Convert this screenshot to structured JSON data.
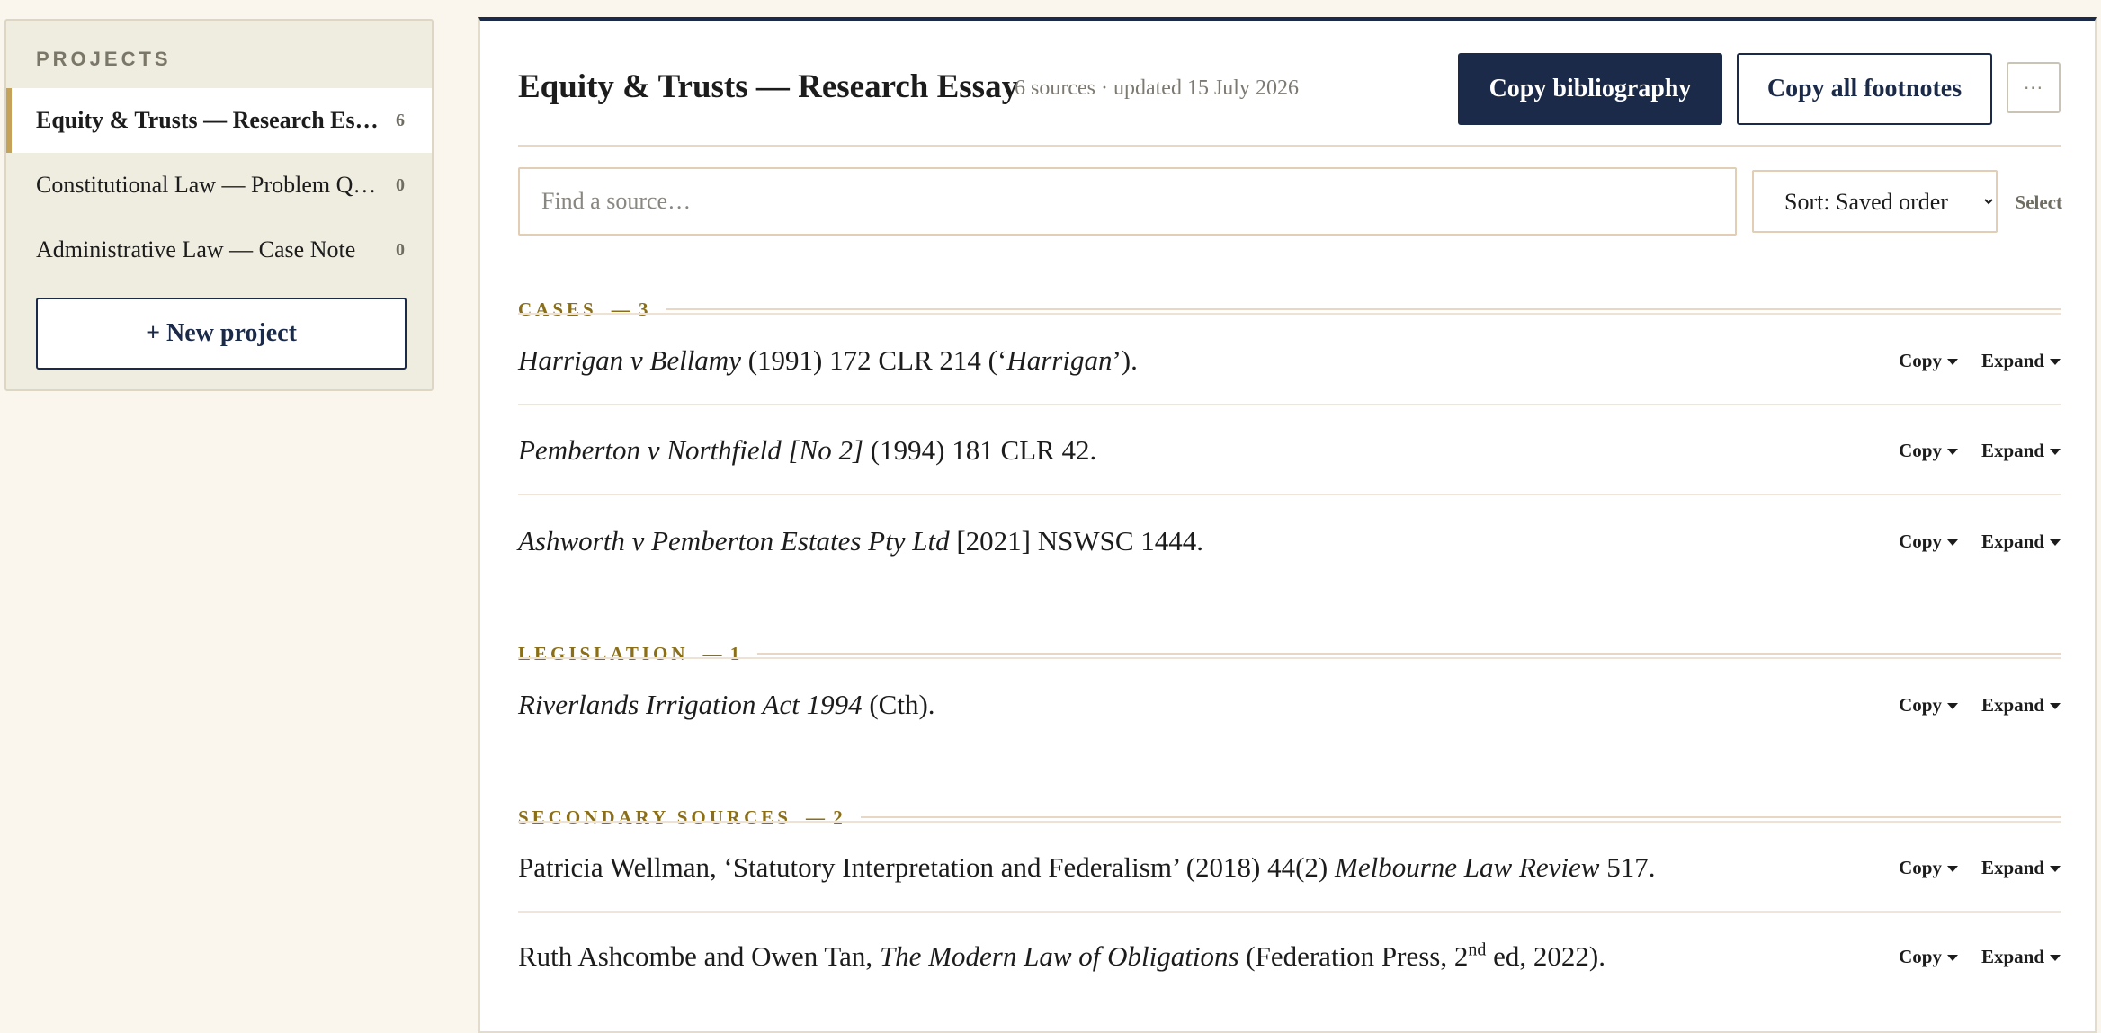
{
  "sidebar": {
    "heading": "PROJECTS",
    "projects": [
      {
        "label": "Equity & Trusts — Research Es…",
        "count": "6",
        "active": true
      },
      {
        "label": "Constitutional Law — Problem Q…",
        "count": "0",
        "active": false
      },
      {
        "label": "Administrative Law — Case Note",
        "count": "0",
        "active": false
      }
    ],
    "new_project_label": "+ New project"
  },
  "header": {
    "title": "Equity & Trusts — Research Essay",
    "meta": "6 sources · updated 15 July 2026",
    "copy_bibliography": "Copy bibliography",
    "copy_footnotes": "Copy all footnotes",
    "more": "···"
  },
  "toolbar": {
    "search_placeholder": "Find a source…",
    "sort_value": "Sort: Saved order",
    "select_label": "Select"
  },
  "row_actions": {
    "copy": "Copy",
    "expand": "Expand"
  },
  "sections": [
    {
      "label": "CASES",
      "count": "— 3",
      "sources": [
        [
          {
            "t": "Harrigan v Bellamy",
            "i": true
          },
          {
            "t": " (1991) 172 CLR 214 (‘"
          },
          {
            "t": "Harrigan",
            "i": true
          },
          {
            "t": "’)."
          }
        ],
        [
          {
            "t": "Pemberton v Northfield [No 2]",
            "i": true
          },
          {
            "t": " (1994) 181 CLR 42."
          }
        ],
        [
          {
            "t": "Ashworth v Pemberton Estates Pty Ltd",
            "i": true
          },
          {
            "t": " [2021] NSWSC 1444."
          }
        ]
      ]
    },
    {
      "label": "LEGISLATION",
      "count": "— 1",
      "sources": [
        [
          {
            "t": "Riverlands Irrigation Act 1994",
            "i": true
          },
          {
            "t": " (Cth)."
          }
        ]
      ]
    },
    {
      "label": "SECONDARY SOURCES",
      "count": "— 2",
      "sources": [
        [
          {
            "t": "Patricia Wellman, ‘Statutory Interpretation and Federalism’ (2018) 44(2) "
          },
          {
            "t": "Melbourne Law Review",
            "i": true
          },
          {
            "t": " 517."
          }
        ],
        [
          {
            "t": "Ruth Ashcombe and Owen Tan, "
          },
          {
            "t": "The Modern Law of Obligations",
            "i": true
          },
          {
            "t": " (Federation Press, 2"
          },
          {
            "t": "nd",
            "sup": true
          },
          {
            "t": " ed, 2022)."
          }
        ]
      ]
    }
  ],
  "colors": {
    "navy": "#1b2a48",
    "accent_gold": "#8b6f18",
    "active_bar": "#c4a25a"
  },
  "icons": {
    "caret": "caret-down-icon",
    "more": "more-horizontal-icon"
  }
}
